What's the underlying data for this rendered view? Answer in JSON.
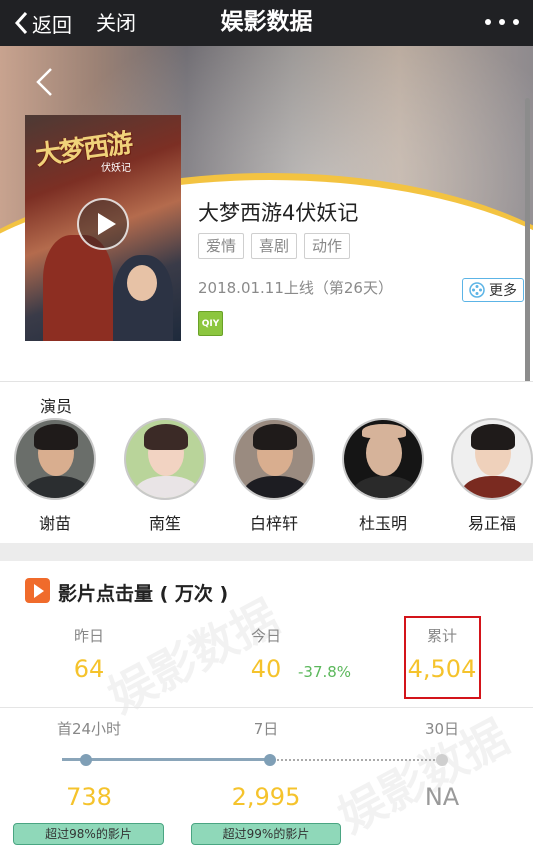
{
  "nav": {
    "back_label": "返回",
    "close_label": "关闭",
    "title": "娱影数据"
  },
  "movie": {
    "poster_title": "大梦西游",
    "poster_subtitle": "伏妖记",
    "title": "大梦西游4伏妖记",
    "genres": [
      "爱情",
      "喜剧",
      "动作"
    ],
    "release": "2018.01.11上线（第26天）",
    "more_label": "更多",
    "platform_label": "QIY"
  },
  "cast": {
    "label": "演员",
    "members": [
      {
        "name": "谢苗"
      },
      {
        "name": "南笙"
      },
      {
        "name": "白梓轩"
      },
      {
        "name": "杜玉明"
      },
      {
        "name": "易正福"
      }
    ]
  },
  "stats": {
    "title": "影片点击量 ( 万次 )",
    "watermark": "娱影数据",
    "yesterday": {
      "label": "昨日",
      "value": "64"
    },
    "today": {
      "label": "今日",
      "value": "40",
      "change": "-37.8%"
    },
    "total": {
      "label": "累计",
      "value": "4,504"
    },
    "periods": [
      {
        "label": "首24小时",
        "value": "738",
        "badge": "超过98%的影片"
      },
      {
        "label": "7日",
        "value": "2,995",
        "badge": "超过99%的影片"
      },
      {
        "label": "30日",
        "value": "NA",
        "badge": ""
      }
    ]
  },
  "colors": {
    "accent_yellow": "#f5c32c",
    "change_green": "#5cb85c",
    "badge_green": "#8fd8b9",
    "highlight_red": "#d3141a"
  }
}
